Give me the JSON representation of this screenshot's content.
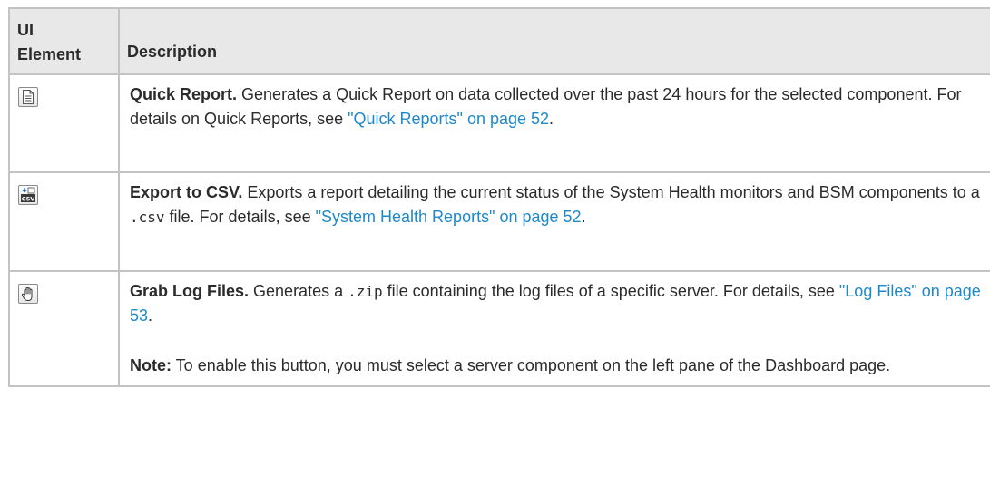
{
  "table": {
    "headers": {
      "ui_element_line1": "UI",
      "ui_element_line2": "Element",
      "description": "Description"
    },
    "rows": [
      {
        "icon": "report-document-icon",
        "term": "Quick Report.",
        "text": " Generates a Quick Report on data collected over the past 24 hours for the selected component. For details on Quick Reports, see ",
        "link": "\"Quick Reports\" on page 52",
        "tail": "."
      },
      {
        "icon": "export-csv-icon",
        "term": "Export to CSV.",
        "text_before": " Exports a report detailing the current status of the System Health monitors and BSM components to a ",
        "code": ".csv",
        "text_after": " file. For details, see ",
        "link": "\"System Health Reports\" on page 52",
        "tail": "."
      },
      {
        "icon": "grab-hand-icon",
        "term": "Grab Log Files.",
        "text_before": " Generates a ",
        "code": ".zip",
        "text_after": " file containing the log files of a specific server. For details, see ",
        "link": "\"Log Files\" on page 53",
        "tail": ".",
        "note_label": "Note:",
        "note_text": " To enable this button, you must select a server component on the left pane of the Dashboard page."
      }
    ]
  },
  "colors": {
    "link": "#1e88c8",
    "header_bg": "#e8e8e8",
    "border": "#c3c3c3",
    "text": "#2b2b2b"
  }
}
